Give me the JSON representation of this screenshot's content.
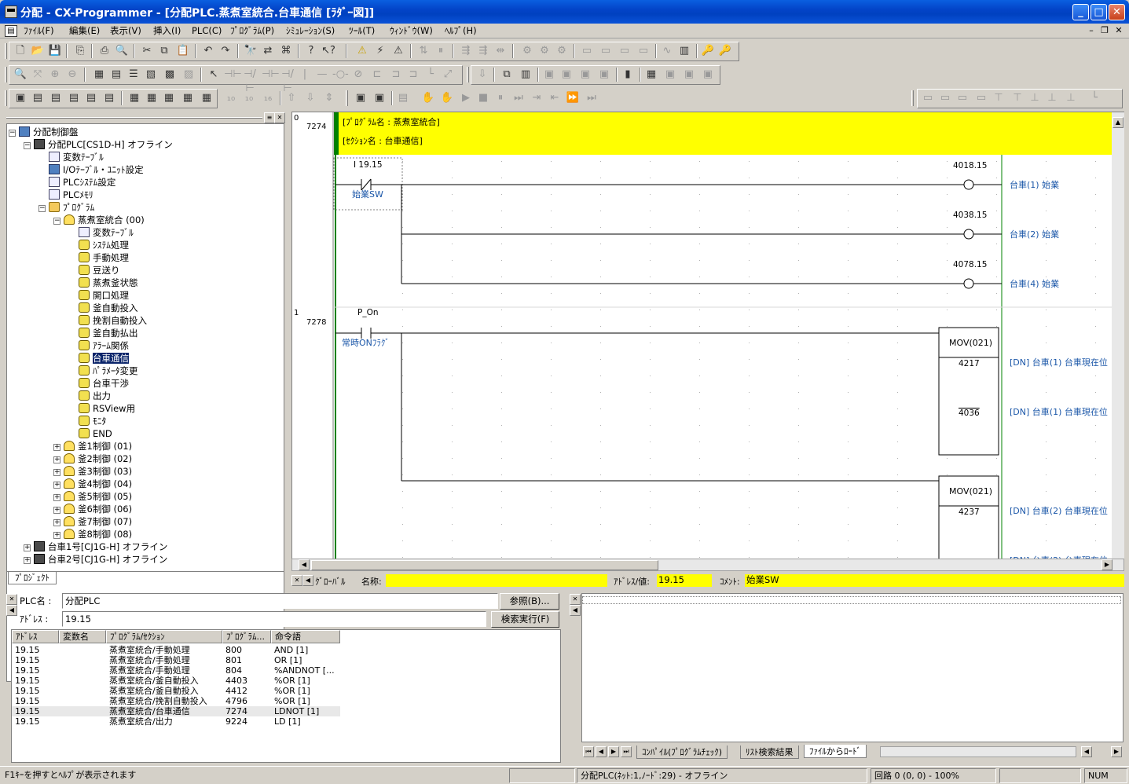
{
  "window": {
    "title": "分配 - CX-Programmer - [分配PLC.蒸煮室統合.台車通信 [ﾗﾀﾞｰ図]]"
  },
  "menu": [
    "ﾌｧｲﾙ(F)",
    "編集(E)",
    "表示(V)",
    "挿入(I)",
    "PLC(C)",
    "ﾌﾟﾛｸﾞﾗﾑ(P)",
    "ｼﾐｭﾚｰｼｮﾝ(S)",
    "ﾂｰﾙ(T)",
    "ｳｨﾝﾄﾞｳ(W)",
    "ﾍﾙﾌﾟ(H)"
  ],
  "project_tree": {
    "tab_label": "ﾌﾟﾛｼﾞｪｸﾄ",
    "nodes": [
      {
        "label": "分配制御盤",
        "indent": 0,
        "exp": "−",
        "icon": "network-icon"
      },
      {
        "label": "分配PLC[CS1D-H] オフライン",
        "indent": 1,
        "exp": "−",
        "icon": "plc-icon"
      },
      {
        "label": "変数ﾃｰﾌﾞﾙ",
        "indent": 2,
        "exp": "",
        "icon": "symbol-table-icon"
      },
      {
        "label": "I/Oﾃｰﾌﾞﾙ・ﾕﾆｯﾄ設定",
        "indent": 2,
        "exp": "",
        "icon": "io-table-icon"
      },
      {
        "label": "PLCｼｽﾃﾑ設定",
        "indent": 2,
        "exp": "",
        "icon": "settings-icon"
      },
      {
        "label": "PLCﾒﾓﾘ",
        "indent": 2,
        "exp": "",
        "icon": "memory-icon"
      },
      {
        "label": "ﾌﾟﾛｸﾞﾗﾑ",
        "indent": 2,
        "exp": "−",
        "icon": "programs-icon"
      },
      {
        "label": "蒸煮室統合 (00)",
        "indent": 3,
        "exp": "−",
        "icon": "task-icon"
      },
      {
        "label": "変数ﾃｰﾌﾞﾙ",
        "indent": 4,
        "exp": "",
        "icon": "symbol-table-icon"
      },
      {
        "label": "ｼｽﾃﾑ処理",
        "indent": 4,
        "exp": "",
        "icon": "section-icon"
      },
      {
        "label": "手動処理",
        "indent": 4,
        "exp": "",
        "icon": "section-icon"
      },
      {
        "label": "豆送り",
        "indent": 4,
        "exp": "",
        "icon": "section-icon"
      },
      {
        "label": "蒸煮釜状態",
        "indent": 4,
        "exp": "",
        "icon": "section-icon"
      },
      {
        "label": "開口処理",
        "indent": 4,
        "exp": "",
        "icon": "section-icon"
      },
      {
        "label": "釜自動投入",
        "indent": 4,
        "exp": "",
        "icon": "section-icon"
      },
      {
        "label": "挽割自動投入",
        "indent": 4,
        "exp": "",
        "icon": "section-icon"
      },
      {
        "label": "釜自動払出",
        "indent": 4,
        "exp": "",
        "icon": "section-icon"
      },
      {
        "label": "ｱﾗｰﾑ関係",
        "indent": 4,
        "exp": "",
        "icon": "section-icon"
      },
      {
        "label": "台車通信",
        "indent": 4,
        "exp": "",
        "icon": "section-icon",
        "selected": true
      },
      {
        "label": "ﾊﾟﾗﾒｰﾀ変更",
        "indent": 4,
        "exp": "",
        "icon": "section-icon"
      },
      {
        "label": "台車干渉",
        "indent": 4,
        "exp": "",
        "icon": "section-icon"
      },
      {
        "label": "出力",
        "indent": 4,
        "exp": "",
        "icon": "section-icon"
      },
      {
        "label": "RSView用",
        "indent": 4,
        "exp": "",
        "icon": "section-icon"
      },
      {
        "label": "ﾓﾆﾀ",
        "indent": 4,
        "exp": "",
        "icon": "section-icon"
      },
      {
        "label": "END",
        "indent": 4,
        "exp": "",
        "icon": "section-icon"
      },
      {
        "label": "釜1制御 (01)",
        "indent": 3,
        "exp": "+",
        "icon": "task-icon"
      },
      {
        "label": "釜2制御 (02)",
        "indent": 3,
        "exp": "+",
        "icon": "task-icon"
      },
      {
        "label": "釜3制御 (03)",
        "indent": 3,
        "exp": "+",
        "icon": "task-icon"
      },
      {
        "label": "釜4制御 (04)",
        "indent": 3,
        "exp": "+",
        "icon": "task-icon"
      },
      {
        "label": "釜5制御 (05)",
        "indent": 3,
        "exp": "+",
        "icon": "task-icon"
      },
      {
        "label": "釜6制御 (06)",
        "indent": 3,
        "exp": "+",
        "icon": "task-icon"
      },
      {
        "label": "釜7制御 (07)",
        "indent": 3,
        "exp": "+",
        "icon": "task-icon"
      },
      {
        "label": "釜8制御 (08)",
        "indent": 3,
        "exp": "+",
        "icon": "task-icon"
      },
      {
        "label": "台車1号[CJ1G-H] オフライン",
        "indent": 1,
        "exp": "+",
        "icon": "plc-icon"
      },
      {
        "label": "台車2号[CJ1G-H] オフライン",
        "indent": 1,
        "exp": "+",
        "icon": "plc-icon"
      }
    ]
  },
  "ladder": {
    "header": {
      "program": "[ﾌﾟﾛｸﾞﾗﾑ名 : 蒸煮室統合]",
      "section": "[ｾｸｼｮﾝ名 : 台車通信]"
    },
    "rung0": {
      "number": "0",
      "step": "7274",
      "contact_addr": "I 19.15",
      "contact_comment": "始業SW",
      "coils": [
        {
          "addr": "4018.15",
          "comment": "台車(1) 始業"
        },
        {
          "addr": "4038.15",
          "comment": "台車(2) 始業"
        },
        {
          "addr": "4078.15",
          "comment": "台車(4) 始業"
        }
      ]
    },
    "rung1": {
      "number": "1",
      "step": "7278",
      "contact_addr": "P_On",
      "contact_comment": "常時ONﾌﾗｸﾞ",
      "blocks": [
        {
          "name": "MOV(021)",
          "op1": "4217",
          "op2": "4036",
          "c1": "[DN] 台車(1) 台車現在位",
          "c2": "[DN] 台車(1) 台車現在位"
        },
        {
          "name": "MOV(021)",
          "op1": "4237",
          "op2": "",
          "c1": "[DN] 台車(2) 台車現在位",
          "c2": "[DN] 台車(2) 台車現在位"
        }
      ]
    }
  },
  "infobar": {
    "scope": "ｸﾞﾛｰﾊﾞﾙ",
    "name_label": "名称:",
    "name_value": "",
    "addr_label": "ｱﾄﾞﾚｽ/値:",
    "addr_value": "19.15",
    "comment_label": "ｺﾒﾝﾄ:",
    "comment_value": "始業SW"
  },
  "search": {
    "plc_label": "PLC名 :",
    "plc_value": "分配PLC",
    "addr_label": "ｱﾄﾞﾚｽ :",
    "addr_value": "19.15",
    "browse_button": "参照(B)...",
    "find_button": "検索実行(F)",
    "columns": [
      "ｱﾄﾞﾚｽ",
      "変数名",
      "ﾌﾟﾛｸﾞﾗﾑ/ｾｸｼｮﾝ",
      "ﾌﾟﾛｸﾞﾗﾑ...",
      "命令語"
    ],
    "rows": [
      [
        "19.15",
        "",
        "蒸煮室統合/手動処理",
        "800",
        "AND [1]"
      ],
      [
        "19.15",
        "",
        "蒸煮室統合/手動処理",
        "801",
        "OR [1]"
      ],
      [
        "19.15",
        "",
        "蒸煮室統合/手動処理",
        "804",
        "%ANDNOT [..."
      ],
      [
        "19.15",
        "",
        "蒸煮室統合/釜自動投入",
        "4403",
        "%OR [1]"
      ],
      [
        "19.15",
        "",
        "蒸煮室統合/釜自動投入",
        "4412",
        "%OR [1]"
      ],
      [
        "19.15",
        "",
        "蒸煮室統合/挽割自動投入",
        "4796",
        "%OR [1]"
      ],
      [
        "19.15",
        "",
        "蒸煮室統合/台車通信",
        "7274",
        "LDNOT [1]"
      ],
      [
        "19.15",
        "",
        "蒸煮室統合/出力",
        "9224",
        "LD [1]"
      ]
    ]
  },
  "output": {
    "tabs": [
      "ｺﾝﾊﾟｲﾙ(ﾌﾟﾛｸﾞﾗﾑﾁｪｯｸ)",
      "ﾘｽﾄ検索結果",
      "ﾌｧｲﾙからﾛｰﾄﾞ"
    ]
  },
  "statusbar": {
    "help": "F1ｷｰを押すとﾍﾙﾌﾟが表示されます",
    "plc": "分配PLC(ﾈｯﾄ:1,ﾉｰﾄﾞ:29) - オフライン",
    "rung": "回路 0 (0, 0) - 100%",
    "num": "NUM"
  },
  "colors": {
    "title": "#0a52d8",
    "highlight": "#ffff00",
    "ladder_line": "#000000",
    "rail": "#008000",
    "comment": "#1a56a8"
  }
}
